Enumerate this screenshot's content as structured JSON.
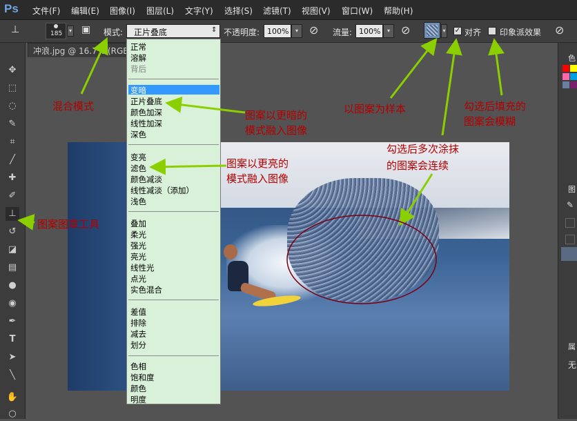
{
  "app": {
    "logo": "Ps"
  },
  "menubar": {
    "items": [
      "文件(F)",
      "编辑(E)",
      "图像(I)",
      "图层(L)",
      "文字(Y)",
      "选择(S)",
      "滤镜(T)",
      "视图(V)",
      "窗口(W)",
      "帮助(H)"
    ]
  },
  "options": {
    "brush_size": "185",
    "mode_label": "模式:",
    "mode_value": "正片叠底",
    "opacity_label": "不透明度:",
    "opacity_value": "100%",
    "flow_label": "流量:",
    "flow_value": "100%",
    "align_label": "对齐",
    "align_checked": true,
    "impressionist_label": "印象派效果",
    "impressionist_checked": false
  },
  "document": {
    "tab_title": "冲浪.jpg @ 16.7% (RGB/8)"
  },
  "blend_menu": {
    "selected": "变暗",
    "groups": [
      [
        "正常",
        "溶解",
        "背后"
      ],
      [
        "变暗",
        "正片叠底",
        "颜色加深",
        "线性加深",
        "深色"
      ],
      [
        "变亮",
        "滤色",
        "颜色减淡",
        "线性减淡（添加）",
        "浅色"
      ],
      [
        "叠加",
        "柔光",
        "强光",
        "亮光",
        "线性光",
        "点光",
        "实色混合"
      ],
      [
        "差值",
        "排除",
        "减去",
        "划分"
      ],
      [
        "色相",
        "饱和度",
        "颜色",
        "明度"
      ]
    ]
  },
  "annotations": {
    "blend_mode": "混合模式",
    "darker": [
      "图案以更暗的",
      "模式融入图像"
    ],
    "lighter": [
      "图案以更亮的",
      "模式融入图像"
    ],
    "stamp_tool": "图案图章工具",
    "sample": "以图案为样本",
    "impressionist": [
      "勾选后填充的",
      "图案会模糊"
    ],
    "aligned": [
      "勾选后多次涂抹",
      "的图案会连续"
    ]
  },
  "right_panel": {
    "color_tab": "色",
    "layers_tab": "图",
    "props_tab": "属",
    "none_text": "无"
  },
  "colors": {
    "annotation": "#b30000",
    "arrow": "#8ccf00",
    "menu_bg": "#d9f0d9",
    "highlight": "#3399ff"
  },
  "icons": [
    "move-icon",
    "marquee-icon",
    "lasso-icon",
    "quick-select-icon",
    "crop-icon",
    "eyedropper-icon",
    "healing-icon",
    "brush-icon",
    "pattern-stamp-icon",
    "history-brush-icon",
    "eraser-icon",
    "gradient-icon",
    "blur-icon",
    "dodge-icon",
    "pen-icon",
    "type-icon",
    "path-select-icon",
    "line-icon",
    "hand-icon",
    "zoom-icon"
  ]
}
